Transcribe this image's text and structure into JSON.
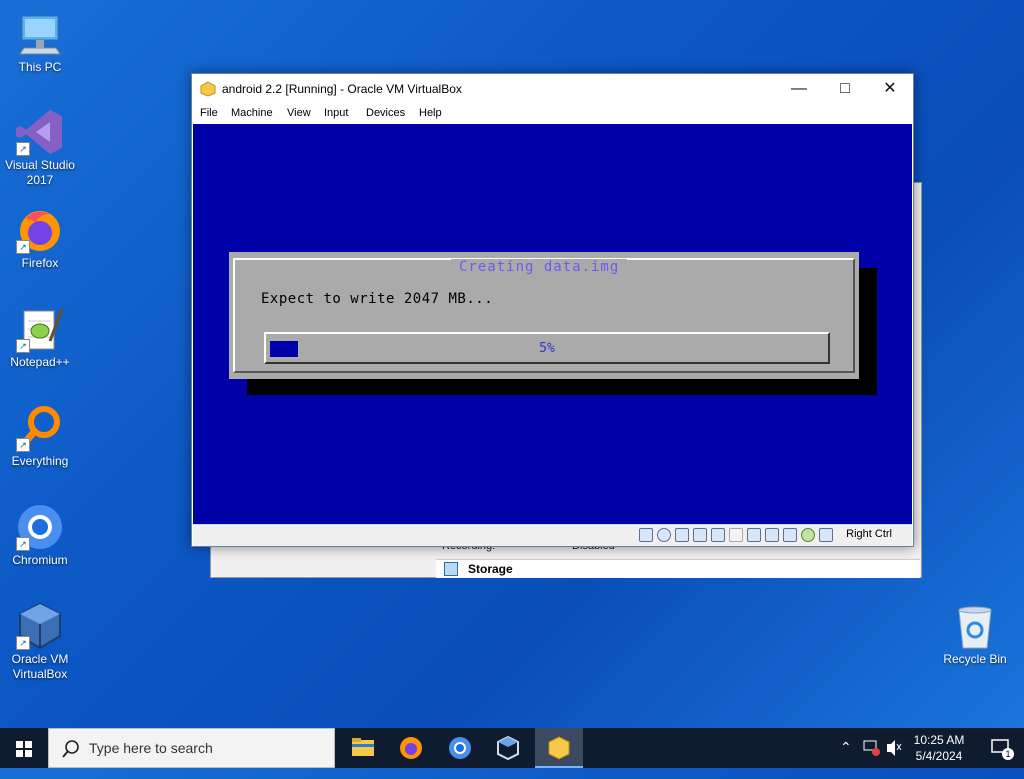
{
  "desktop": {
    "icons": [
      {
        "label": "This PC"
      },
      {
        "label": "Visual Studio 2017"
      },
      {
        "label": "Firefox"
      },
      {
        "label": "Notepad++"
      },
      {
        "label": "Everything"
      },
      {
        "label": "Chromium"
      },
      {
        "label": "Oracle VM VirtualBox"
      },
      {
        "label": "Recycle Bin"
      }
    ]
  },
  "background_window": {
    "recording_label": "Recording:",
    "recording_value": "Disabled",
    "storage_label": "Storage"
  },
  "vm_window": {
    "title": "android 2.2 [Running] - Oracle VM VirtualBox",
    "menu": [
      "File",
      "Machine",
      "View",
      "Input",
      "Devices",
      "Help"
    ],
    "dialog": {
      "title": "Creating data.img",
      "message": "Expect to write 2047 MB...",
      "progress_text": "5%",
      "progress_fraction": 0.05
    },
    "status_text": "Right Ctrl",
    "colors": {
      "screen_bg": "#0000a8",
      "dialog_bg": "#aaaaaa",
      "title_fg": "#6b5cf0"
    }
  },
  "taskbar": {
    "search_placeholder": "Type here to search",
    "time": "10:25 AM",
    "date": "5/4/2024",
    "notification_count": "1",
    "pinned": [
      "file-explorer-icon",
      "firefox-icon",
      "chromium-icon",
      "virtualbox-icon",
      "virtualbox-vm-icon"
    ]
  }
}
